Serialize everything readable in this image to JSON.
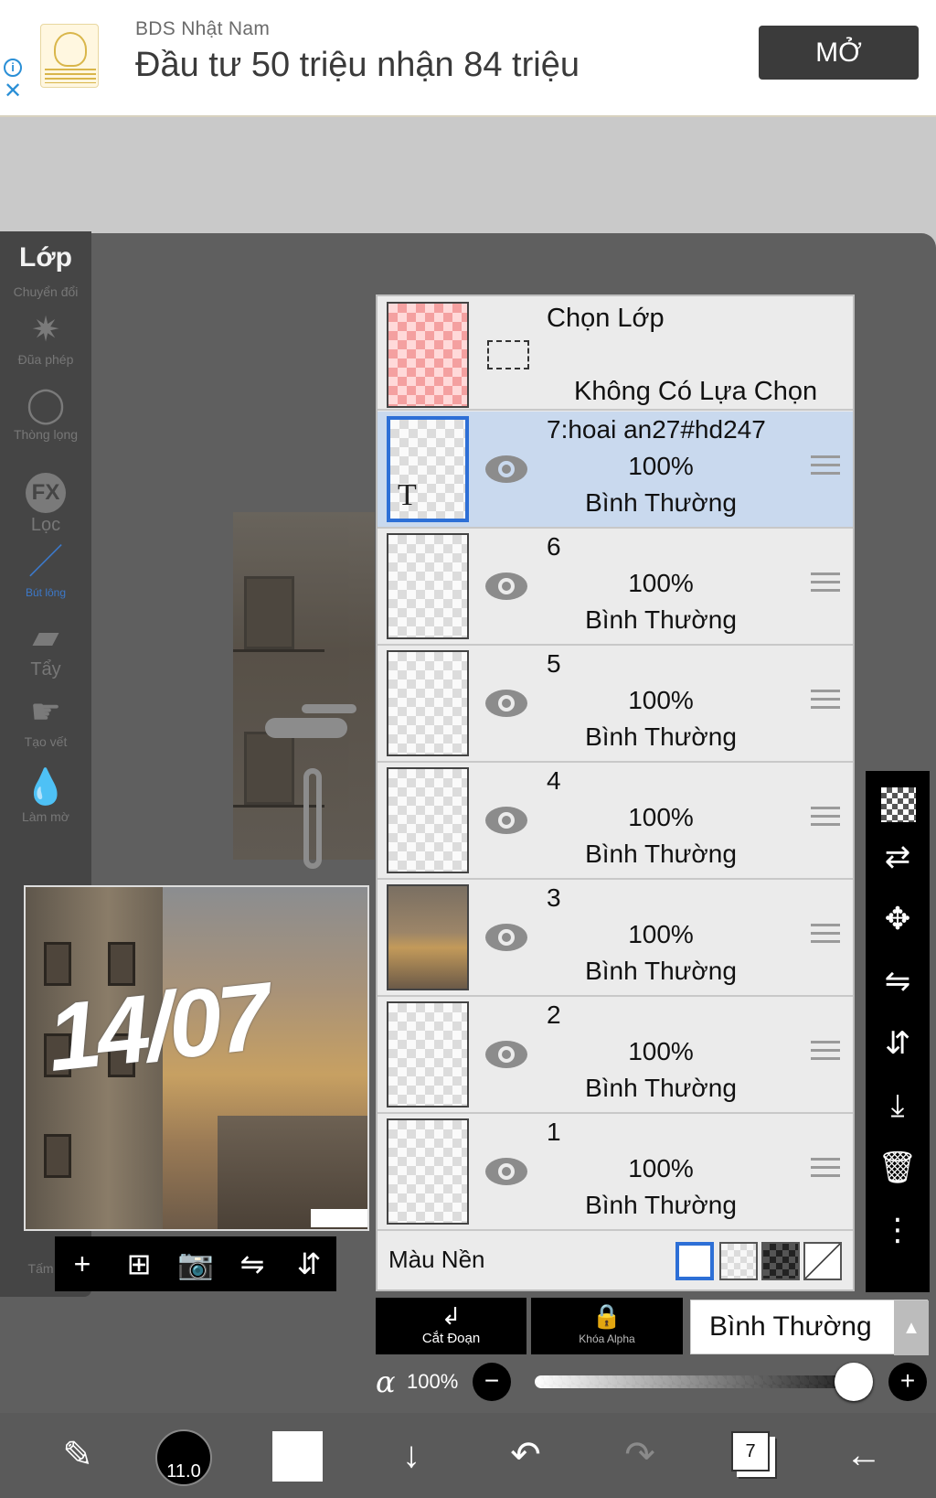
{
  "ad": {
    "sponsor": "BDS Nhật Nam",
    "headline": "Đầu tư 50 triệu nhận 84 triệu",
    "open_label": "MỞ",
    "info_icon": "info-icon",
    "close_icon": "close-icon"
  },
  "left_toolbar": {
    "tools": [
      {
        "id": "layer",
        "label": "Lớp",
        "icon": "layer-icon"
      },
      {
        "id": "transform",
        "label": "Chuyển đổi",
        "icon": "transform-icon"
      },
      {
        "id": "magic-wand",
        "label": "Đũa phép",
        "icon": "magic-wand-icon"
      },
      {
        "id": "lasso",
        "label": "Thòng lọng",
        "icon": "lasso-icon"
      },
      {
        "id": "filter",
        "label": "Lọc",
        "icon": "fx-icon"
      },
      {
        "id": "brush",
        "label": "Bút lông",
        "icon": "brush-icon"
      },
      {
        "id": "eraser",
        "label": "Tẩy",
        "icon": "eraser-icon"
      },
      {
        "id": "smudge",
        "label": "Tạo vết",
        "icon": "smudge-icon"
      },
      {
        "id": "blur",
        "label": "Làm mờ",
        "icon": "blur-drop-icon"
      },
      {
        "id": "canvas",
        "label": "Tấm v",
        "icon": "canvas-icon"
      }
    ]
  },
  "preview": {
    "text": "14/07",
    "toolbar": {
      "add": "+",
      "add_layer": "⊞",
      "camera": "📷",
      "flip_h": "⇋",
      "flip_v": "⇵"
    }
  },
  "layer_panel": {
    "selection": {
      "title": "Chọn Lớp",
      "subtitle": "Không Có Lựa Chọn"
    },
    "layers": [
      {
        "name": "7:hoai an27#hd247",
        "opacity": "100%",
        "blend": "Bình Thường",
        "active": true,
        "text_layer": true,
        "text_mark": "T"
      },
      {
        "name": "6",
        "opacity": "100%",
        "blend": "Bình Thường"
      },
      {
        "name": "5",
        "opacity": "100%",
        "blend": "Bình Thường"
      },
      {
        "name": "4",
        "opacity": "100%",
        "blend": "Bình Thường"
      },
      {
        "name": "3",
        "opacity": "100%",
        "blend": "Bình Thường",
        "photo": true
      },
      {
        "name": "2",
        "opacity": "100%",
        "blend": "Bình Thường"
      },
      {
        "name": "1",
        "opacity": "100%",
        "blend": "Bình Thường"
      }
    ],
    "background": {
      "label": "Màu Nền",
      "options": [
        "white",
        "transparent-light",
        "transparent-dark",
        "none"
      ],
      "selected": "white"
    }
  },
  "right_toolbar": {
    "icons": [
      "checkerboard-icon",
      "swap-layers-icon",
      "move-icon",
      "flip-horizontal-icon",
      "flip-vertical-icon",
      "merge-down-icon",
      "trash-icon",
      "more-icon"
    ]
  },
  "bottom_controls": {
    "clip_label": "Cắt Đoạn",
    "alpha_lock_label": "Khóa Alpha",
    "blend_mode": "Bình Thường",
    "alpha_symbol": "α",
    "alpha_value": "100%",
    "alpha_fraction": 1.0
  },
  "bottom_bar": {
    "brush_size": "11.0",
    "layer_count": "7",
    "primary_color": "#ffffff",
    "active_tool_color": "#3c78c8"
  }
}
